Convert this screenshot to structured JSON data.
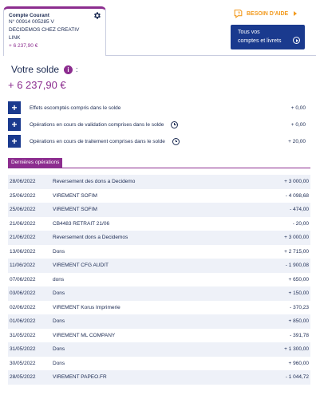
{
  "account": {
    "title": "Compte Courant",
    "number": "N° 00914 005285 V",
    "holder_line1": "DECIDEMOS CHEZ CREATIV",
    "holder_line2": "LINK",
    "amount": "+ 6 237,90 €",
    "icon": "gear-icon"
  },
  "help": {
    "label": "BESOIN D'AIDE",
    "icon": "help-bubble-icon"
  },
  "accounts_button": {
    "line1": "Tous vos",
    "line2": "comptes et livrets",
    "icon": "arrow-circle-icon"
  },
  "balance": {
    "title": "Votre solde",
    "info_icon_text": "i",
    "colon": ":",
    "amount": "+ 6 237,90 €"
  },
  "details": [
    {
      "label": "Effets escomptés compris dans le solde",
      "value": "+ 0,00",
      "has_clock": false
    },
    {
      "label": "Opérations en cours de validation comprises dans le solde",
      "value": "+ 0,00",
      "has_clock": true
    },
    {
      "label": "Opérations en cours de traitement comprises dans le solde",
      "value": "+ 20,00",
      "has_clock": true
    }
  ],
  "expand_symbol": "+",
  "operations_header": "Dernières opérations",
  "operations": [
    {
      "date": "28/06/2022",
      "label": "Reversement des dons a Decidemo",
      "amount": "+ 3 000,00"
    },
    {
      "date": "25/06/2022",
      "label": "VIREMENT SOFIM",
      "amount": "- 4 098,68"
    },
    {
      "date": "25/06/2022",
      "label": "VIREMENT SOFIM",
      "amount": "- 474,00"
    },
    {
      "date": "21/06/2022",
      "label": "CB4483 RETRAIT 21/06",
      "amount": "- 20,00"
    },
    {
      "date": "21/06/2022",
      "label": "Reversement dons a Decidemos",
      "amount": "+ 3 000,00"
    },
    {
      "date": "13/06/2022",
      "label": "Dons",
      "amount": "+ 2 715,00"
    },
    {
      "date": "11/06/2022",
      "label": "VIREMENT CFG AUDIT",
      "amount": "- 1 900,08"
    },
    {
      "date": "07/06/2022",
      "label": "dons",
      "amount": "+ 650,00"
    },
    {
      "date": "03/06/2022",
      "label": "Dons",
      "amount": "+ 150,00"
    },
    {
      "date": "02/06/2022",
      "label": "VIREMENT Korus Imprimerie",
      "amount": "- 370,23"
    },
    {
      "date": "01/06/2022",
      "label": "Dons",
      "amount": "+ 850,00"
    },
    {
      "date": "31/05/2022",
      "label": "VIREMENT ML COMPANY",
      "amount": "- 391,78"
    },
    {
      "date": "31/05/2022",
      "label": "Dons",
      "amount": "+ 1 300,00"
    },
    {
      "date": "30/05/2022",
      "label": "Dons",
      "amount": "+ 960,00"
    },
    {
      "date": "28/05/2022",
      "label": "VIREMENT PAPEO.FR",
      "amount": "- 1 044,72"
    }
  ]
}
